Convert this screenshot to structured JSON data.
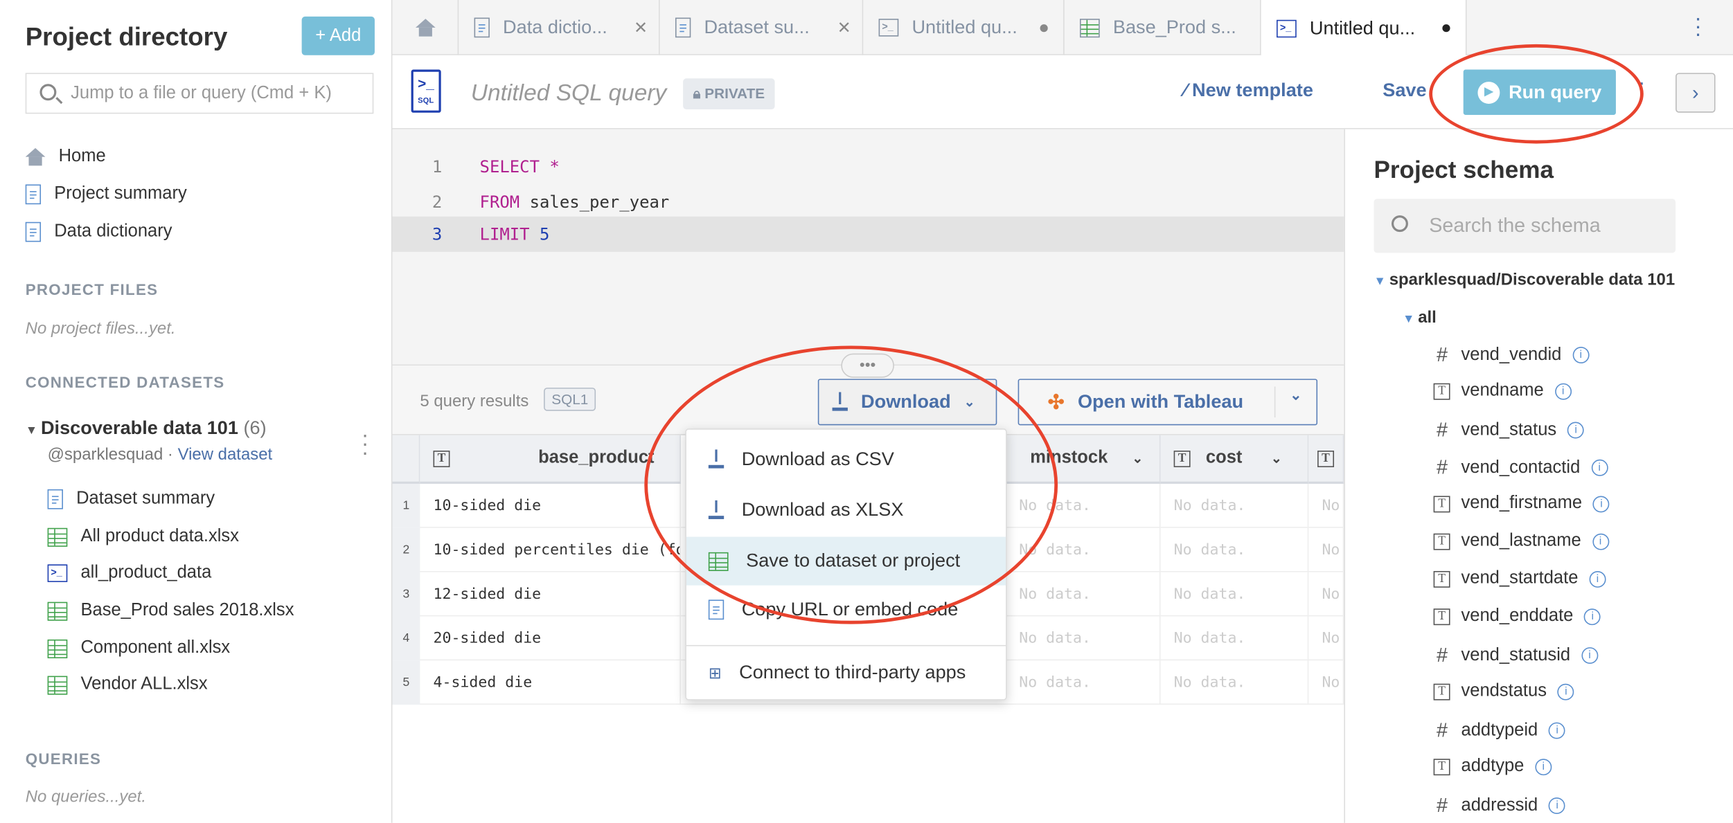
{
  "sidebar": {
    "title": "Project directory",
    "add_label": "+ Add",
    "search_placeholder": "Jump to a file or query (Cmd + K)",
    "nav": [
      {
        "label": "Home",
        "icon": "home-icon"
      },
      {
        "label": "Project summary",
        "icon": "document-icon"
      },
      {
        "label": "Data dictionary",
        "icon": "document-icon"
      }
    ],
    "project_files_heading": "PROJECT FILES",
    "project_files_empty": "No project files...yet.",
    "connected_heading": "CONNECTED DATASETS",
    "dataset": {
      "name": "Discoverable data 101",
      "count": "(6)",
      "owner": "@sparklesquad ·",
      "view_link": "View dataset"
    },
    "dataset_items": [
      {
        "label": "Dataset summary",
        "icon": "document-icon"
      },
      {
        "label": "All product data.xlsx",
        "icon": "spreadsheet-icon"
      },
      {
        "label": "all_product_data",
        "icon": "sql-query-icon"
      },
      {
        "label": "Base_Prod sales 2018.xlsx",
        "icon": "spreadsheet-icon"
      },
      {
        "label": "Component all.xlsx",
        "icon": "spreadsheet-icon"
      },
      {
        "label": "Vendor ALL.xlsx",
        "icon": "spreadsheet-icon"
      }
    ],
    "queries_heading": "QUERIES",
    "queries_empty": "No queries...yet."
  },
  "tabs": [
    {
      "label": "Data dictio..."
    },
    {
      "label": "Dataset su..."
    },
    {
      "label": "Untitled qu..."
    },
    {
      "label": "Base_Prod s..."
    },
    {
      "label": "Untitled qu...",
      "active": true
    }
  ],
  "header": {
    "icon_label": "SQL",
    "title": "Untitled SQL query",
    "badge": "PRIVATE",
    "new_template": "New template",
    "save": "Save",
    "run": "Run query"
  },
  "editor": {
    "lines": [
      {
        "n": "1",
        "kw": "SELECT",
        "rest": " *"
      },
      {
        "n": "2",
        "kw": "FROM",
        "rest": " sales_per_year"
      },
      {
        "n": "3",
        "kw": "LIMIT",
        "rest": " 5"
      }
    ]
  },
  "results": {
    "count": "5 query results",
    "tag": "SQL1",
    "download": "Download",
    "tableau": "Open with Tableau",
    "columns": [
      "base_product",
      "minstock",
      "cost"
    ],
    "rows": [
      {
        "n": "1",
        "v": "10-sided die"
      },
      {
        "n": "2",
        "v": "10-sided percentiles die (fo"
      },
      {
        "n": "3",
        "v": "12-sided die"
      },
      {
        "n": "4",
        "v": "20-sided die"
      },
      {
        "n": "5",
        "v": "4-sided die"
      }
    ],
    "no_data": "No data."
  },
  "menu": {
    "items": [
      "Download as CSV",
      "Download as XLSX",
      "Save to dataset or project",
      "Copy URL or embed code",
      "Connect to third-party apps"
    ]
  },
  "schema": {
    "title": "Project schema",
    "search_placeholder": "Search the schema",
    "root": "sparklesquad/Discoverable data 101",
    "table": "all",
    "columns": [
      {
        "name": "vend_vendid",
        "type": "#"
      },
      {
        "name": "vendname",
        "type": "T"
      },
      {
        "name": "vend_status",
        "type": "#"
      },
      {
        "name": "vend_contactid",
        "type": "#"
      },
      {
        "name": "vend_firstname",
        "type": "T"
      },
      {
        "name": "vend_lastname",
        "type": "T"
      },
      {
        "name": "vend_startdate",
        "type": "T"
      },
      {
        "name": "vend_enddate",
        "type": "T"
      },
      {
        "name": "vend_statusid",
        "type": "#"
      },
      {
        "name": "vendstatus",
        "type": "T"
      },
      {
        "name": "addtypeid",
        "type": "#"
      },
      {
        "name": "addtype",
        "type": "T"
      },
      {
        "name": "addressid",
        "type": "#"
      }
    ]
  },
  "colors": {
    "accent": "#78bfd9",
    "link": "#4a6fa8",
    "annotation": "#e8432e",
    "keyword": "#b0208f"
  }
}
